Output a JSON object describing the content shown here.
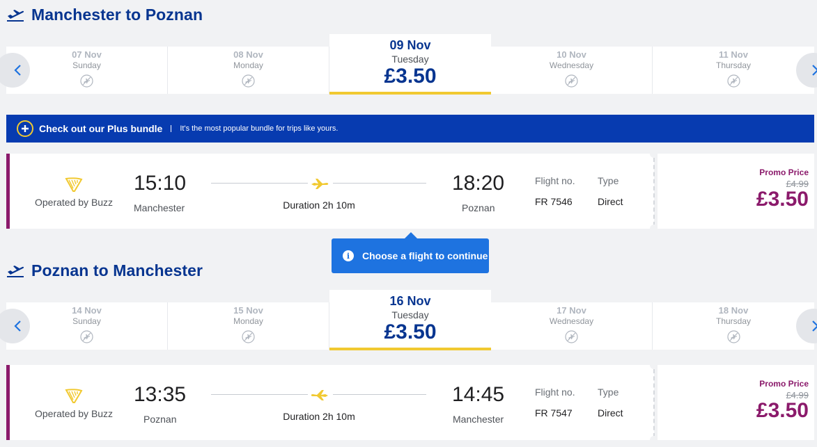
{
  "outbound": {
    "title": "Manchester to Poznan",
    "dates": [
      {
        "date": "07 Nov",
        "weekday": "Sunday",
        "price": null
      },
      {
        "date": "08 Nov",
        "weekday": "Monday",
        "price": null
      },
      {
        "date": "09 Nov",
        "weekday": "Tuesday",
        "price": "£3.50"
      },
      {
        "date": "10 Nov",
        "weekday": "Wednesday",
        "price": null
      },
      {
        "date": "11 Nov",
        "weekday": "Thursday",
        "price": null
      }
    ],
    "flight": {
      "operator": "Operated by Buzz",
      "depart_time": "15:10",
      "depart_city": "Manchester",
      "duration": "Duration 2h 10m",
      "arrive_time": "18:20",
      "arrive_city": "Poznan",
      "flight_no_label": "Flight no.",
      "flight_no": "FR 7546",
      "type_label": "Type",
      "type": "Direct",
      "promo_label": "Promo Price",
      "old_price": "£4.99",
      "price": "£3.50"
    }
  },
  "banner": {
    "title": "Check out our Plus bundle",
    "text": "It's the most popular bundle for trips like yours."
  },
  "tooltip": {
    "text": "Choose a flight to continue"
  },
  "inbound": {
    "title": "Poznan to Manchester",
    "dates": [
      {
        "date": "14 Nov",
        "weekday": "Sunday",
        "price": null
      },
      {
        "date": "15 Nov",
        "weekday": "Monday",
        "price": null
      },
      {
        "date": "16 Nov",
        "weekday": "Tuesday",
        "price": "£3.50"
      },
      {
        "date": "17 Nov",
        "weekday": "Wednesday",
        "price": null
      },
      {
        "date": "18 Nov",
        "weekday": "Thursday",
        "price": null
      }
    ],
    "flight": {
      "operator": "Operated by Buzz",
      "depart_time": "13:35",
      "depart_city": "Poznan",
      "duration": "Duration 2h 10m",
      "arrive_time": "14:45",
      "arrive_city": "Manchester",
      "flight_no_label": "Flight no.",
      "flight_no": "FR 7547",
      "type_label": "Type",
      "type": "Direct",
      "promo_label": "Promo Price",
      "old_price": "£4.99",
      "price": "£3.50"
    }
  },
  "colors": {
    "brand_blue": "#073590",
    "banner_blue": "#073bb0",
    "promo_purple": "#8b1a6b",
    "accent_yellow": "#f1c931",
    "tooltip_blue": "#1e73e0"
  },
  "icons": {
    "section": "plane-departure-icon",
    "no_flights": "no-flight-icon",
    "prev": "chevron-left-icon",
    "next": "chevron-right-icon",
    "operator": "ryanair-harp-logo",
    "flight_plane": "plane-icon",
    "plus": "plus-circle-icon",
    "info": "info-icon"
  }
}
